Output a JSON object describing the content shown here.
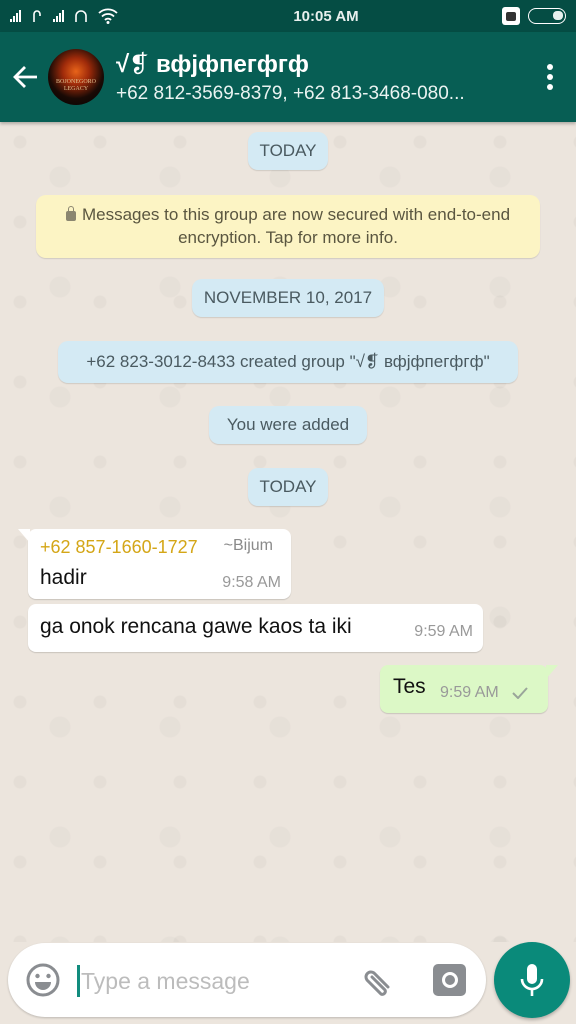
{
  "status_bar": {
    "time": "10:05 AM",
    "icons": [
      "signal-icon",
      "data-icon",
      "signal-icon",
      "data-icon",
      "wifi-icon",
      "bbm-icon",
      "battery-icon"
    ]
  },
  "header": {
    "back_icon": "arrow-left-icon",
    "avatar_text": "BOJONEGORO LEGACY",
    "title": "√❡ вфјфпегфгф",
    "subtitle": "+62 812-3569-8379, +62 813-3468-080...",
    "menu_icon": "more-vert-icon"
  },
  "chat": {
    "date_today_1": "TODAY",
    "encryption_notice": "Messages to this group are now secured with end-to-end encryption. Tap for more info.",
    "date_nov": "NOVEMBER 10, 2017",
    "created_notice": "+62 823-3012-8433 created group \"√❡ вфјфпегфгф\"",
    "added_notice": "You were added",
    "date_today_2": "TODAY",
    "messages": [
      {
        "direction": "incoming",
        "sender": "+62 857-1660-1727",
        "alias": "~Bijum",
        "text": "hadir",
        "time": "9:58 AM"
      },
      {
        "direction": "incoming",
        "text": "ga onok rencana gawe kaos ta iki",
        "time": "9:59 AM"
      },
      {
        "direction": "outgoing",
        "text": "Tes",
        "time": "9:59 AM",
        "status": "sent"
      }
    ]
  },
  "input": {
    "placeholder": "Type a message",
    "value": "",
    "emoji_icon": "emoji-icon",
    "attach_icon": "paperclip-icon",
    "camera_icon": "camera-icon",
    "mic_icon": "mic-icon"
  },
  "colors": {
    "status_bar": "#054D44",
    "app_bar": "#075E54",
    "outgoing_bubble": "#DCF8C6",
    "system_pill": "#D4EAF4",
    "encryption_bg": "#FCF4C4",
    "sender_name": "#D4A617",
    "accent": "#0A8A7A"
  }
}
